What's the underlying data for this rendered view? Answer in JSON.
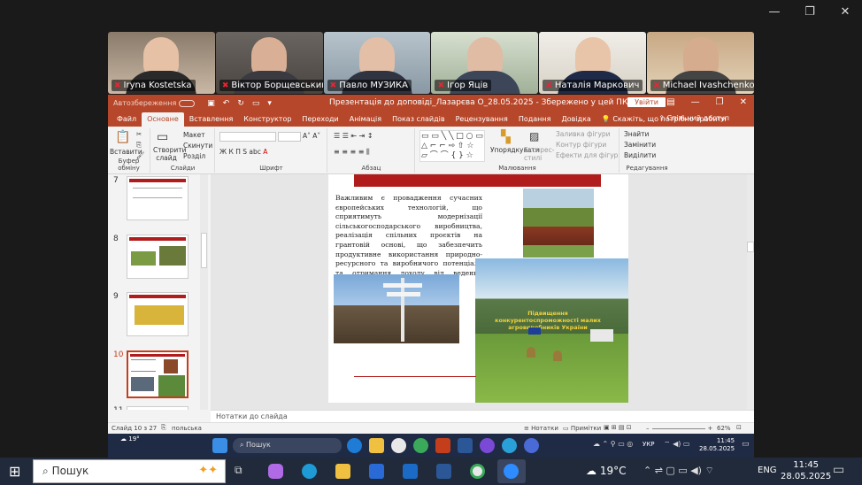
{
  "window_controls": {
    "minimize": "—",
    "restore": "❐",
    "close": "✕"
  },
  "participants": [
    {
      "name": "Iryna Kostetska"
    },
    {
      "name": "Віктор Борщевський"
    },
    {
      "name": "Павло МУЗИКА"
    },
    {
      "name": "Ігор Яців"
    },
    {
      "name": "Наталія Маркович"
    },
    {
      "name": "Michael Ivashchenko"
    }
  ],
  "ppt": {
    "autosave_label": "Автозбереження",
    "doc_title": "Презентація до доповіді_Лазарєва О_28.05.2025  -  Збережено у цей ПК",
    "signin": "Увійти",
    "share": "Спільний доступ",
    "tabs": [
      "Файл",
      "Основне",
      "Вставлення",
      "Конструктор",
      "Переходи",
      "Анімація",
      "Показ слайдів",
      "Рецензування",
      "Подання",
      "Довідка"
    ],
    "tell_me": "Скажіть, що потрібно зробити",
    "ribbon": {
      "paste": "Вставити",
      "clipboard": "Буфер обміну",
      "new_slide": "Створити слайд",
      "layout": "Макет",
      "reset": "Скинути",
      "section": "Розділ",
      "slides_group": "Слайди",
      "font_group": "Шрифт",
      "paragraph_group": "Абзац",
      "arrange": "Упорядкувати",
      "quick_styles": "Експрес-стилі",
      "shape_fill": "Заливка фігури",
      "shape_outline": "Контур фігури",
      "shape_effects": "Ефекти для фігур",
      "drawing_group": "Малювання",
      "find": "Знайти",
      "replace": "Замінити",
      "select": "Виділити",
      "editing_group": "Редагування",
      "font_buttons": [
        "Ж",
        "К",
        "П",
        "S",
        "abc"
      ]
    },
    "thumbnails": [
      {
        "num": "7"
      },
      {
        "num": "8"
      },
      {
        "num": "9"
      },
      {
        "num": "10"
      },
      {
        "num": "11"
      }
    ],
    "slide_text": "Важливим є провадження сучасних європейських технологій, що сприятимуть модернізації сільськогосподарського виробництва, реалізація спільних проєктів на грантовій основі, що забезпечить продуктивне використання природно-ресурсного та виробничого потенціалу та отримання доходу від ведення агробізнесу.",
    "poster_title": "Підвищення конкурентоспроможності малих агровиробників України",
    "notes_placeholder": "Нотатки до слайда",
    "status": {
      "slide_of": "Слайд 10 з 27",
      "language": "польська",
      "notes": "Нотатки",
      "comments": "Примітки",
      "zoom": "62%"
    }
  },
  "inner_taskbar": {
    "weather_temp": "19°",
    "search": "Пошук",
    "lang": "УКР",
    "time": "11:45",
    "date": "28.05.2025"
  },
  "taskbar": {
    "search": "Пошук",
    "temp": "19°C",
    "lang": "ENG",
    "time": "11:45",
    "date": "28.05.2025"
  },
  "colors": {
    "ppt_accent": "#b7472a",
    "slide_banner": "#b01c1c"
  }
}
